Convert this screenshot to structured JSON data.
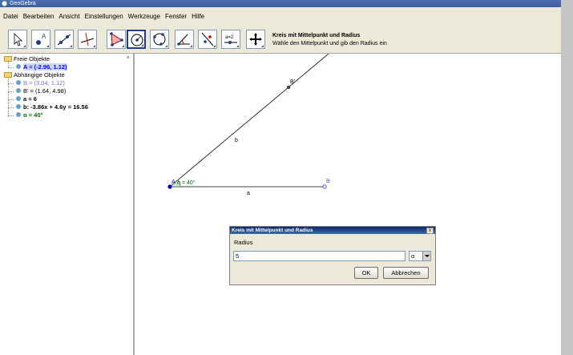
{
  "window": {
    "title": "GeoGebra"
  },
  "menu": [
    "Datei",
    "Bearbeiten",
    "Ansicht",
    "Einstellungen",
    "Werkzeuge",
    "Fenster",
    "Hilfe"
  ],
  "toolbar": {
    "tools": [
      {
        "name": "move-tool"
      },
      {
        "name": "point-tool"
      },
      {
        "name": "line-tool"
      },
      {
        "name": "perpendicular-tool"
      },
      {
        "name": "polygon-tool"
      },
      {
        "name": "circle-center-radius-tool",
        "active": true
      },
      {
        "name": "circle-three-points-tool"
      },
      {
        "name": "angle-tool"
      },
      {
        "name": "reflect-tool"
      },
      {
        "name": "slider-tool"
      },
      {
        "name": "move-view-tool"
      }
    ],
    "help_title": "Kreis mit Mittelpunkt und Radius",
    "help_text": "Wähle den Mittelpunkt und gib den Radius ein",
    "slider_glyph": "a=2"
  },
  "algebra": {
    "free_label": "Freie Objekte",
    "free_items": [
      {
        "text": "A = (-2.96, 1.12)",
        "color": "#0000ff",
        "bold": true
      }
    ],
    "dependent_label": "Abhängige Objekte",
    "dependent_items": [
      {
        "text": "B = (3.04, 1.12)",
        "color": "#7070ff",
        "bold": false
      },
      {
        "text": "B' = (1.64, 4.98)",
        "color": "#000000",
        "bold": false
      },
      {
        "text": "a = 6",
        "color": "#000000",
        "bold": true
      },
      {
        "text": "b: -3.86x + 4.6y = 16.56",
        "color": "#000000",
        "bold": true
      },
      {
        "text": "α = 40°",
        "color": "#007000",
        "bold": true
      }
    ],
    "close_glyph": "×"
  },
  "canvas": {
    "labels": {
      "A": "A",
      "B": "B",
      "Bp": "B'",
      "a": "a",
      "b": "b",
      "alpha": "α = 40°"
    },
    "colors": {
      "accent": "#0000ff",
      "angle": "#007000",
      "line": "#000000"
    }
  },
  "dialog": {
    "title": "Kreis mit Mittelpunkt und Radius",
    "label": "Radius",
    "value": "5",
    "symbol": "α",
    "ok": "OK",
    "cancel": "Abbrechen",
    "close_glyph": "x"
  }
}
